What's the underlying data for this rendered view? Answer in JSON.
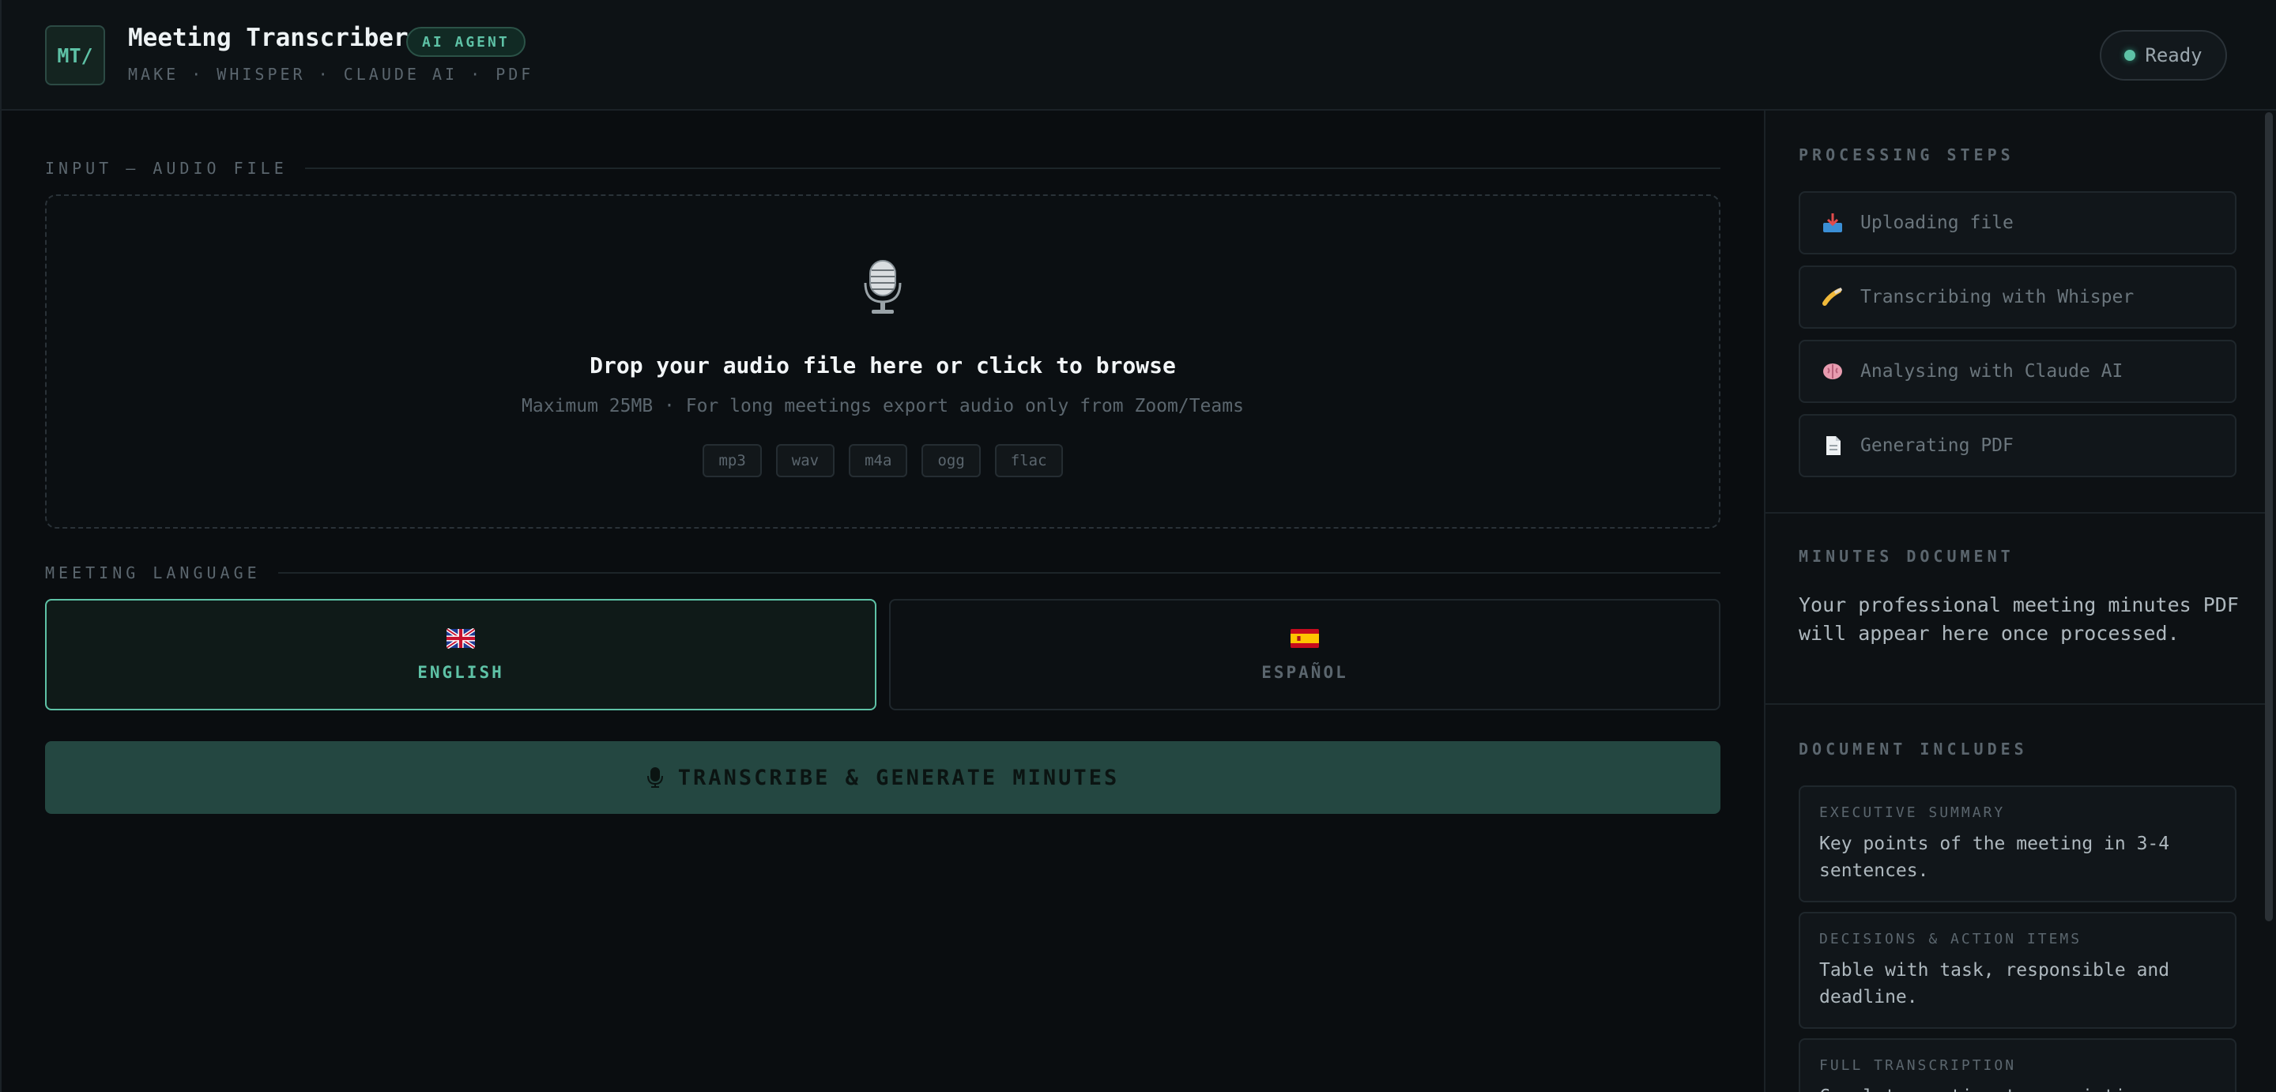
{
  "header": {
    "logo_text": "MT/",
    "title": "Meeting Transcriber",
    "badge": "AI AGENT",
    "subtitle": "MAKE · WHISPER · CLAUDE AI · PDF",
    "status": "Ready"
  },
  "input": {
    "section_label": "INPUT — AUDIO FILE",
    "drop_title": "Drop your audio file here or click to browse",
    "drop_hint": "Maximum 25MB · For long meetings export audio only from Zoom/Teams",
    "formats": [
      "mp3",
      "wav",
      "m4a",
      "ogg",
      "flac"
    ]
  },
  "language": {
    "section_label": "MEETING LANGUAGE",
    "options": [
      {
        "label": "ENGLISH",
        "selected": true
      },
      {
        "label": "ESPAÑOL",
        "selected": false
      }
    ]
  },
  "action": {
    "transcribe_label": "TRANSCRIBE & GENERATE MINUTES"
  },
  "sidebar": {
    "steps_label": "PROCESSING STEPS",
    "steps": [
      {
        "label": "Uploading file",
        "icon": "inbox-tray-icon"
      },
      {
        "label": "Transcribing with Whisper",
        "icon": "writing-hand-icon"
      },
      {
        "label": "Analysing with Claude AI",
        "icon": "brain-icon"
      },
      {
        "label": "Generating PDF",
        "icon": "document-icon"
      }
    ],
    "minutes_label": "MINUTES DOCUMENT",
    "minutes_text": "Your professional meeting minutes PDF will appear here once processed.",
    "includes_label": "DOCUMENT INCLUDES",
    "includes": [
      {
        "title": "EXECUTIVE SUMMARY",
        "text": "Key points of the meeting in 3-4 sentences."
      },
      {
        "title": "DECISIONS & ACTION ITEMS",
        "text": "Table with task, responsible and deadline."
      },
      {
        "title": "FULL TRANSCRIPTION",
        "text": "Complete meeting transcription."
      }
    ]
  },
  "colors": {
    "accent": "#5ec2a6",
    "background": "#0a0d10",
    "button": "#244741"
  }
}
